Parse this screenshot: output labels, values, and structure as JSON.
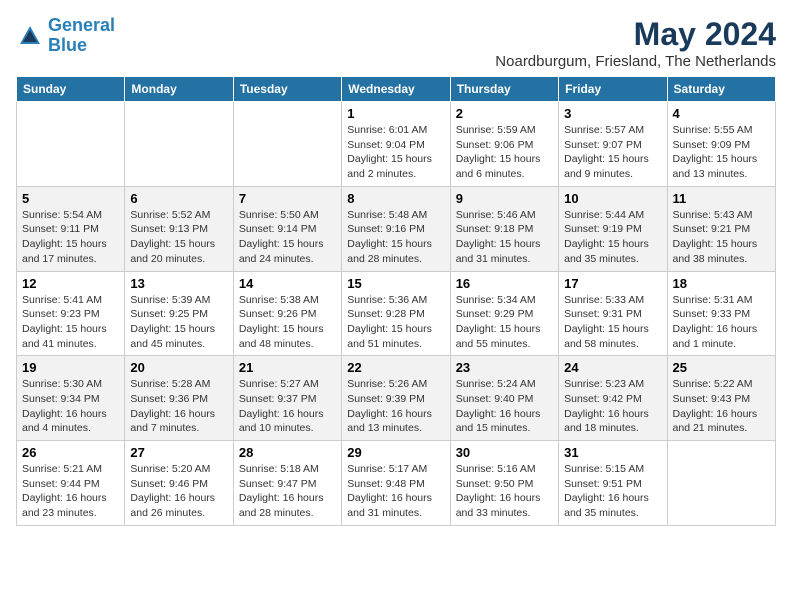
{
  "logo": {
    "line1": "General",
    "line2": "Blue"
  },
  "title": "May 2024",
  "location": "Noardburgum, Friesland, The Netherlands",
  "days_of_week": [
    "Sunday",
    "Monday",
    "Tuesday",
    "Wednesday",
    "Thursday",
    "Friday",
    "Saturday"
  ],
  "weeks": [
    [
      {
        "num": "",
        "info": ""
      },
      {
        "num": "",
        "info": ""
      },
      {
        "num": "",
        "info": ""
      },
      {
        "num": "1",
        "info": "Sunrise: 6:01 AM\nSunset: 9:04 PM\nDaylight: 15 hours\nand 2 minutes."
      },
      {
        "num": "2",
        "info": "Sunrise: 5:59 AM\nSunset: 9:06 PM\nDaylight: 15 hours\nand 6 minutes."
      },
      {
        "num": "3",
        "info": "Sunrise: 5:57 AM\nSunset: 9:07 PM\nDaylight: 15 hours\nand 9 minutes."
      },
      {
        "num": "4",
        "info": "Sunrise: 5:55 AM\nSunset: 9:09 PM\nDaylight: 15 hours\nand 13 minutes."
      }
    ],
    [
      {
        "num": "5",
        "info": "Sunrise: 5:54 AM\nSunset: 9:11 PM\nDaylight: 15 hours\nand 17 minutes."
      },
      {
        "num": "6",
        "info": "Sunrise: 5:52 AM\nSunset: 9:13 PM\nDaylight: 15 hours\nand 20 minutes."
      },
      {
        "num": "7",
        "info": "Sunrise: 5:50 AM\nSunset: 9:14 PM\nDaylight: 15 hours\nand 24 minutes."
      },
      {
        "num": "8",
        "info": "Sunrise: 5:48 AM\nSunset: 9:16 PM\nDaylight: 15 hours\nand 28 minutes."
      },
      {
        "num": "9",
        "info": "Sunrise: 5:46 AM\nSunset: 9:18 PM\nDaylight: 15 hours\nand 31 minutes."
      },
      {
        "num": "10",
        "info": "Sunrise: 5:44 AM\nSunset: 9:19 PM\nDaylight: 15 hours\nand 35 minutes."
      },
      {
        "num": "11",
        "info": "Sunrise: 5:43 AM\nSunset: 9:21 PM\nDaylight: 15 hours\nand 38 minutes."
      }
    ],
    [
      {
        "num": "12",
        "info": "Sunrise: 5:41 AM\nSunset: 9:23 PM\nDaylight: 15 hours\nand 41 minutes."
      },
      {
        "num": "13",
        "info": "Sunrise: 5:39 AM\nSunset: 9:25 PM\nDaylight: 15 hours\nand 45 minutes."
      },
      {
        "num": "14",
        "info": "Sunrise: 5:38 AM\nSunset: 9:26 PM\nDaylight: 15 hours\nand 48 minutes."
      },
      {
        "num": "15",
        "info": "Sunrise: 5:36 AM\nSunset: 9:28 PM\nDaylight: 15 hours\nand 51 minutes."
      },
      {
        "num": "16",
        "info": "Sunrise: 5:34 AM\nSunset: 9:29 PM\nDaylight: 15 hours\nand 55 minutes."
      },
      {
        "num": "17",
        "info": "Sunrise: 5:33 AM\nSunset: 9:31 PM\nDaylight: 15 hours\nand 58 minutes."
      },
      {
        "num": "18",
        "info": "Sunrise: 5:31 AM\nSunset: 9:33 PM\nDaylight: 16 hours\nand 1 minute."
      }
    ],
    [
      {
        "num": "19",
        "info": "Sunrise: 5:30 AM\nSunset: 9:34 PM\nDaylight: 16 hours\nand 4 minutes."
      },
      {
        "num": "20",
        "info": "Sunrise: 5:28 AM\nSunset: 9:36 PM\nDaylight: 16 hours\nand 7 minutes."
      },
      {
        "num": "21",
        "info": "Sunrise: 5:27 AM\nSunset: 9:37 PM\nDaylight: 16 hours\nand 10 minutes."
      },
      {
        "num": "22",
        "info": "Sunrise: 5:26 AM\nSunset: 9:39 PM\nDaylight: 16 hours\nand 13 minutes."
      },
      {
        "num": "23",
        "info": "Sunrise: 5:24 AM\nSunset: 9:40 PM\nDaylight: 16 hours\nand 15 minutes."
      },
      {
        "num": "24",
        "info": "Sunrise: 5:23 AM\nSunset: 9:42 PM\nDaylight: 16 hours\nand 18 minutes."
      },
      {
        "num": "25",
        "info": "Sunrise: 5:22 AM\nSunset: 9:43 PM\nDaylight: 16 hours\nand 21 minutes."
      }
    ],
    [
      {
        "num": "26",
        "info": "Sunrise: 5:21 AM\nSunset: 9:44 PM\nDaylight: 16 hours\nand 23 minutes."
      },
      {
        "num": "27",
        "info": "Sunrise: 5:20 AM\nSunset: 9:46 PM\nDaylight: 16 hours\nand 26 minutes."
      },
      {
        "num": "28",
        "info": "Sunrise: 5:18 AM\nSunset: 9:47 PM\nDaylight: 16 hours\nand 28 minutes."
      },
      {
        "num": "29",
        "info": "Sunrise: 5:17 AM\nSunset: 9:48 PM\nDaylight: 16 hours\nand 31 minutes."
      },
      {
        "num": "30",
        "info": "Sunrise: 5:16 AM\nSunset: 9:50 PM\nDaylight: 16 hours\nand 33 minutes."
      },
      {
        "num": "31",
        "info": "Sunrise: 5:15 AM\nSunset: 9:51 PM\nDaylight: 16 hours\nand 35 minutes."
      },
      {
        "num": "",
        "info": ""
      }
    ]
  ]
}
